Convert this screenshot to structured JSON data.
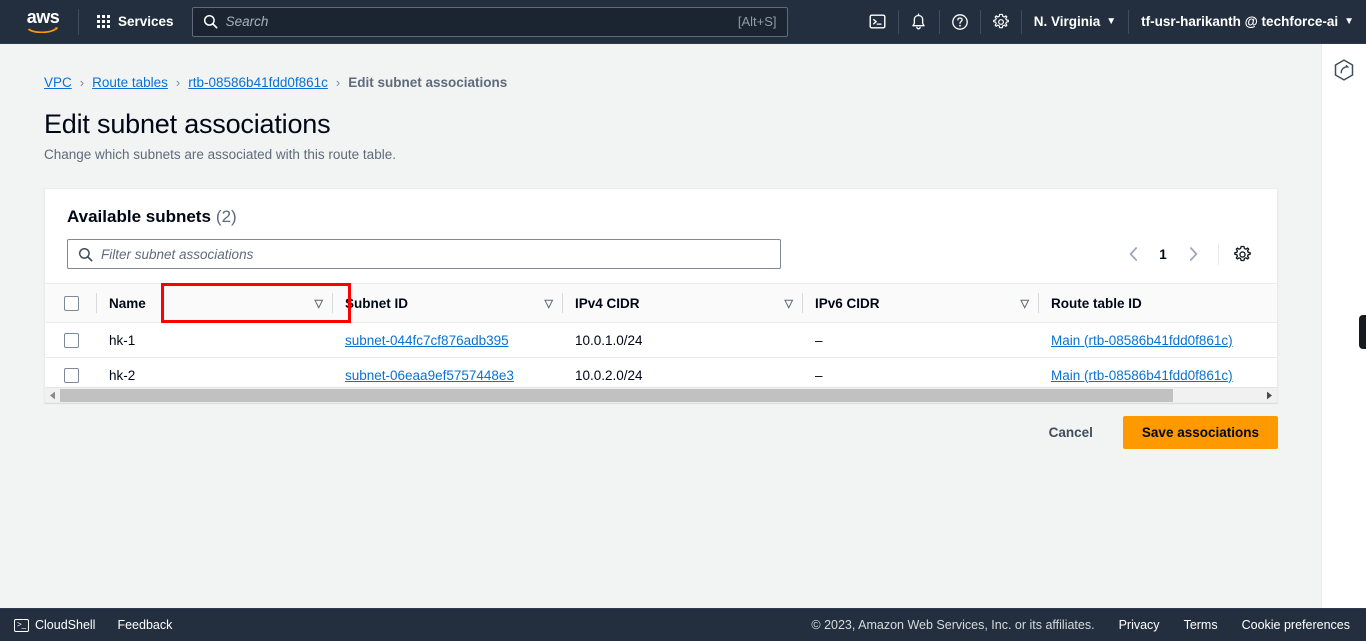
{
  "topnav": {
    "logo_alt": "aws",
    "services_label": "Services",
    "search_placeholder": "Search",
    "search_value": "",
    "search_shortcut": "[Alt+S]",
    "region_label": "N. Virginia",
    "account_label": "tf-usr-harikanth @ techforce-ai",
    "caret": "▼",
    "icons": [
      "cloudshell-icon",
      "notifications-icon",
      "help-icon",
      "settings-icon"
    ]
  },
  "breadcrumb": {
    "items": [
      {
        "label": "VPC",
        "type": "link"
      },
      {
        "label": "Route tables",
        "type": "link"
      },
      {
        "label": "rtb-08586b41fdd0f861c",
        "type": "link"
      },
      {
        "label": "Edit subnet associations",
        "type": "current"
      }
    ],
    "separator": "›"
  },
  "page": {
    "title": "Edit subnet associations",
    "description": "Change which subnets are associated with this route table."
  },
  "card": {
    "title": "Available subnets",
    "count": "(2)",
    "filter_placeholder": "Filter subnet associations",
    "filter_value": "",
    "pagination": {
      "prev": "‹",
      "page": "1",
      "next": "›"
    },
    "settings_icon": "gear-icon",
    "columns": [
      {
        "label": "Name",
        "sortable": true,
        "highlighted": true
      },
      {
        "label": "Subnet ID",
        "sortable": true,
        "highlighted": false
      },
      {
        "label": "IPv4 CIDR",
        "sortable": true,
        "highlighted": false
      },
      {
        "label": "IPv6 CIDR",
        "sortable": true,
        "highlighted": false
      },
      {
        "label": "Route table ID",
        "sortable": false,
        "highlighted": false
      }
    ],
    "rows": [
      {
        "selected": false,
        "name": "hk-1",
        "subnet_id": "subnet-044fc7cf876adb395",
        "ipv4_cidr": "10.0.1.0/24",
        "ipv6_cidr": "–",
        "route_table_id": "Main (rtb-08586b41fdd0f861c)"
      },
      {
        "selected": false,
        "name": "hk-2",
        "subnet_id": "subnet-06eaa9ef5757448e3",
        "ipv4_cidr": "10.0.2.0/24",
        "ipv6_cidr": "–",
        "route_table_id": "Main (rtb-08586b41fdd0f861c)"
      }
    ],
    "scroll_left_arrow": "◂",
    "scroll_right_arrow": "▸"
  },
  "actions": {
    "cancel_label": "Cancel",
    "save_label": "Save associations"
  },
  "right_panel": {
    "icon": "aws-hexagon-icon"
  },
  "footer": {
    "cloudshell_label": "CloudShell",
    "feedback_label": "Feedback",
    "copyright": "© 2023, Amazon Web Services, Inc. or its affiliates.",
    "privacy_label": "Privacy",
    "terms_label": "Terms",
    "cookie_label": "Cookie preferences"
  },
  "colors": {
    "nav_background": "#232f3e",
    "page_background": "#f2f3f3",
    "primary_button": "#ff9900",
    "link": "#0972d3",
    "highlight_box": "#ff0000"
  }
}
